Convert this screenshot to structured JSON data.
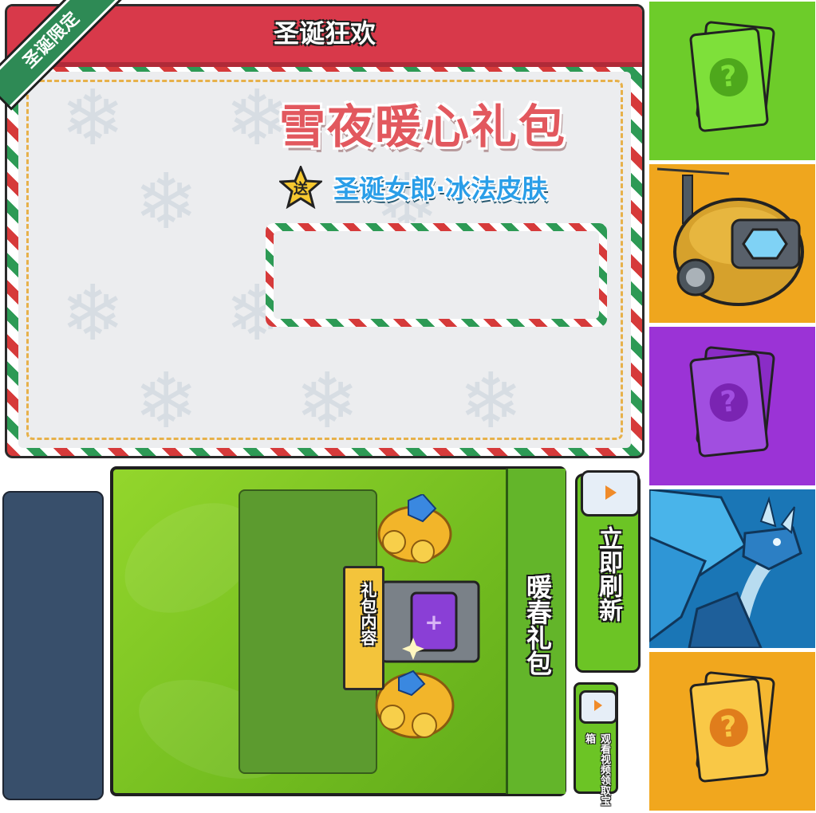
{
  "event_panel": {
    "title": "圣诞狂欢",
    "ribbon": "圣诞限定",
    "pack_name": "雪夜暖心礼包",
    "gift_badge": "送",
    "gift_text": "圣诞女郎·冰法皮肤"
  },
  "pack_card": {
    "name": "暖春礼包",
    "contents_tag": "礼包内容"
  },
  "buttons": {
    "refresh_label": "立即刷新",
    "video_label": "观看视频领取宝箱"
  },
  "tiles": [
    {
      "kind": "mystery-card",
      "color": "#6dcc2a",
      "symbol": "?"
    },
    {
      "kind": "mech-pod",
      "color": "#efa61e"
    },
    {
      "kind": "mystery-card",
      "color": "#9b33d6",
      "symbol": "?"
    },
    {
      "kind": "ice-dragon",
      "color": "#1a76b6"
    },
    {
      "kind": "mystery-card",
      "color": "#f1a71e",
      "symbol": "?"
    }
  ]
}
